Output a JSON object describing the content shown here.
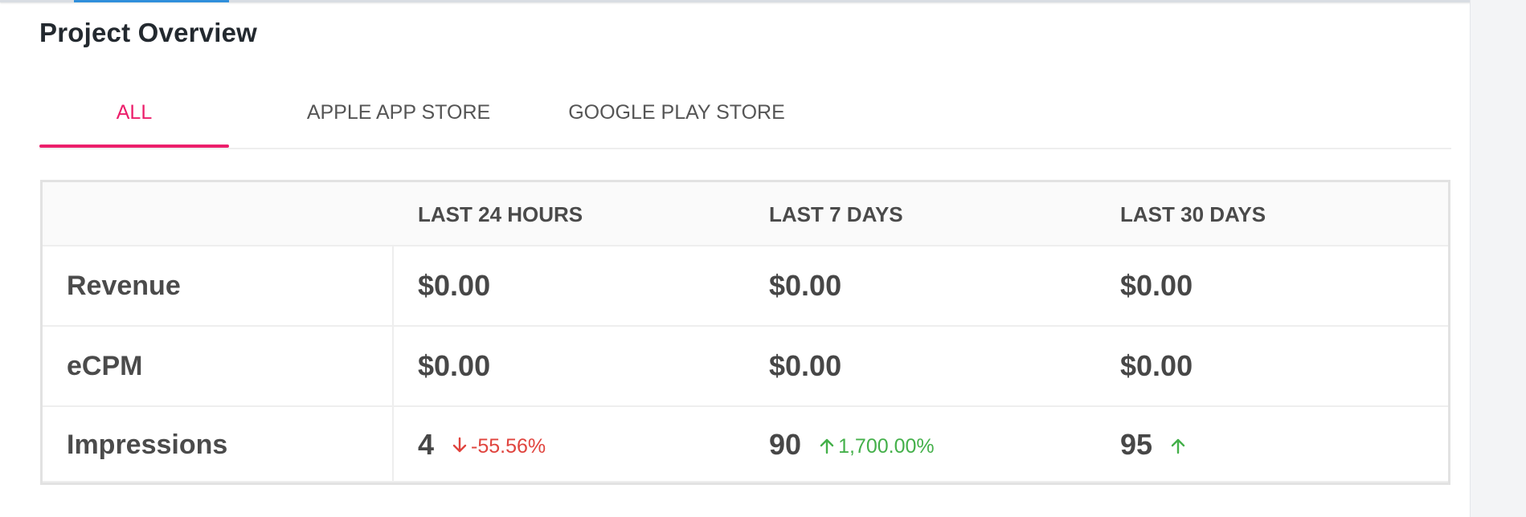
{
  "page_title": "Project Overview",
  "tabs": [
    {
      "label": "ALL",
      "active": true
    },
    {
      "label": "APPLE APP STORE",
      "active": false
    },
    {
      "label": "GOOGLE PLAY STORE",
      "active": false
    }
  ],
  "colors": {
    "accent": "#ec1f6b",
    "up": "#44b04a",
    "down": "#e0443e",
    "top_strip": "#2f8fdb"
  },
  "table": {
    "columns": [
      "LAST 24 HOURS",
      "LAST 7 DAYS",
      "LAST 30 DAYS"
    ],
    "rows": [
      {
        "label": "Revenue",
        "values": [
          "$0.00",
          "$0.00",
          "$0.00"
        ]
      },
      {
        "label": "eCPM",
        "values": [
          "$0.00",
          "$0.00",
          "$0.00"
        ]
      },
      {
        "label": "Impressions",
        "values": [
          "4",
          "90",
          "95"
        ],
        "trends": [
          {
            "direction": "down",
            "icon": "arrow-down-icon",
            "text": "-55.56%"
          },
          {
            "direction": "up",
            "icon": "arrow-up-icon",
            "text": "1,700.00%"
          },
          {
            "direction": "up",
            "icon": "arrow-up-icon",
            "text": ""
          }
        ]
      }
    ]
  }
}
